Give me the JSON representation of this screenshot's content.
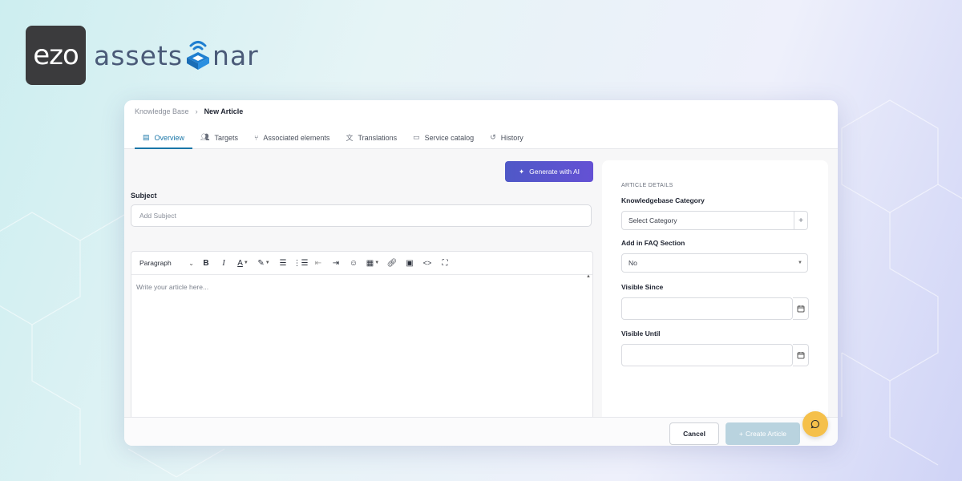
{
  "brand": {
    "ezo_text": "ezo",
    "asset_text": "assets",
    "sonar_suffix": "nar"
  },
  "breadcrumb": {
    "parent": "Knowledge Base",
    "separator": "›",
    "current": "New Article"
  },
  "tabs": [
    {
      "label": "Overview",
      "icon": "document-icon",
      "active": true
    },
    {
      "label": "Targets",
      "icon": "users-icon"
    },
    {
      "label": "Associated elements",
      "icon": "hierarchy-icon"
    },
    {
      "label": "Translations",
      "icon": "translate-icon"
    },
    {
      "label": "Service catalog",
      "icon": "folder-icon"
    },
    {
      "label": "History",
      "icon": "history-icon"
    }
  ],
  "generate_button": {
    "label": "Generate with AI",
    "icon": "sparkle-icon"
  },
  "subject": {
    "label": "Subject",
    "placeholder": "Add Subject"
  },
  "editor": {
    "block_format": "Paragraph",
    "placeholder": "Write your article here..."
  },
  "details": {
    "heading": "ARTICLE DETAILS",
    "category_label": "Knowledgebase Category",
    "category_placeholder": "Select Category",
    "faq_label": "Add in FAQ Section",
    "faq_value": "No",
    "visible_since_label": "Visible Since",
    "visible_until_label": "Visible Until"
  },
  "footer": {
    "cancel_label": "Cancel",
    "create_label": "Create Article",
    "create_prefix": "+"
  },
  "colors": {
    "accent": "#1976a8",
    "ai_button": "#5a54cf",
    "chat": "#f5c04a",
    "create_disabled": "#b9d3df"
  }
}
